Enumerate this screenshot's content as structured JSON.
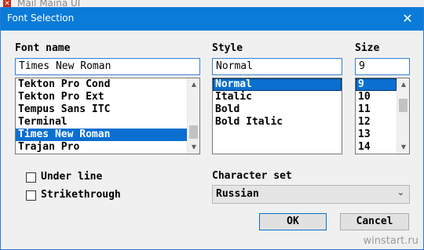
{
  "background_window": {
    "title": "Mail Maina UI"
  },
  "dialog": {
    "title": "Font Selection",
    "font": {
      "label": "Font name",
      "value": "Times New Roman",
      "items": [
        "Tekton Pro Cond",
        "Tekton Pro Ext",
        "Tempus Sans ITC",
        "Terminal",
        "Times New Roman",
        "Trajan Pro"
      ],
      "selected_index": 4
    },
    "style": {
      "label": "Style",
      "value": "Normal",
      "items": [
        "Normal",
        "Italic",
        "Bold",
        "Bold Italic"
      ],
      "selected_index": 0
    },
    "size": {
      "label": "Size",
      "value": "9",
      "items": [
        "9",
        "10",
        "11",
        "12",
        "13",
        "14"
      ],
      "selected_index": 0
    },
    "underline": {
      "label": "Under line",
      "checked": false
    },
    "strikethrough": {
      "label": "Strikethrough",
      "checked": false
    },
    "charset": {
      "label": "Character set",
      "value": "Russian"
    },
    "ok_label": "OK",
    "cancel_label": "Cancel"
  },
  "icons": {
    "close": "close-icon",
    "scroll_up": "scroll-up-arrow-icon",
    "scroll_down": "scroll-down-arrow-icon",
    "dropdown": "chevron-down-icon"
  },
  "colors": {
    "titlebar": "#0a7bd8",
    "selection": "#0a6fd1",
    "focus_border": "#3a7fd0"
  },
  "watermark": "winstart.ru"
}
